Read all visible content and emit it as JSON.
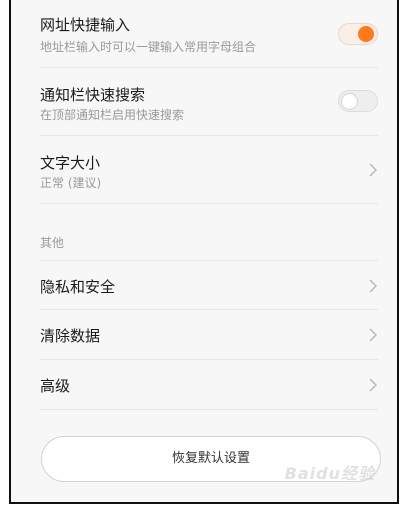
{
  "settings": {
    "url_quick_input": {
      "title": "网址快捷输入",
      "subtitle": "地址栏输入时可以一键输入常用字母组合",
      "enabled": true
    },
    "notification_search": {
      "title": "通知栏快速搜索",
      "subtitle": "在顶部通知栏启用快速搜索",
      "enabled": false
    },
    "font_size": {
      "title": "文字大小",
      "subtitle": "正常 (建议)"
    }
  },
  "other_section": {
    "label": "其他",
    "items": [
      {
        "label": "隐私和安全"
      },
      {
        "label": "清除数据"
      },
      {
        "label": "高级"
      }
    ]
  },
  "reset_button": {
    "label": "恢复默认设置"
  },
  "watermark": {
    "text": "Baidu经验"
  },
  "colors": {
    "accent": "#ff7a1a"
  }
}
